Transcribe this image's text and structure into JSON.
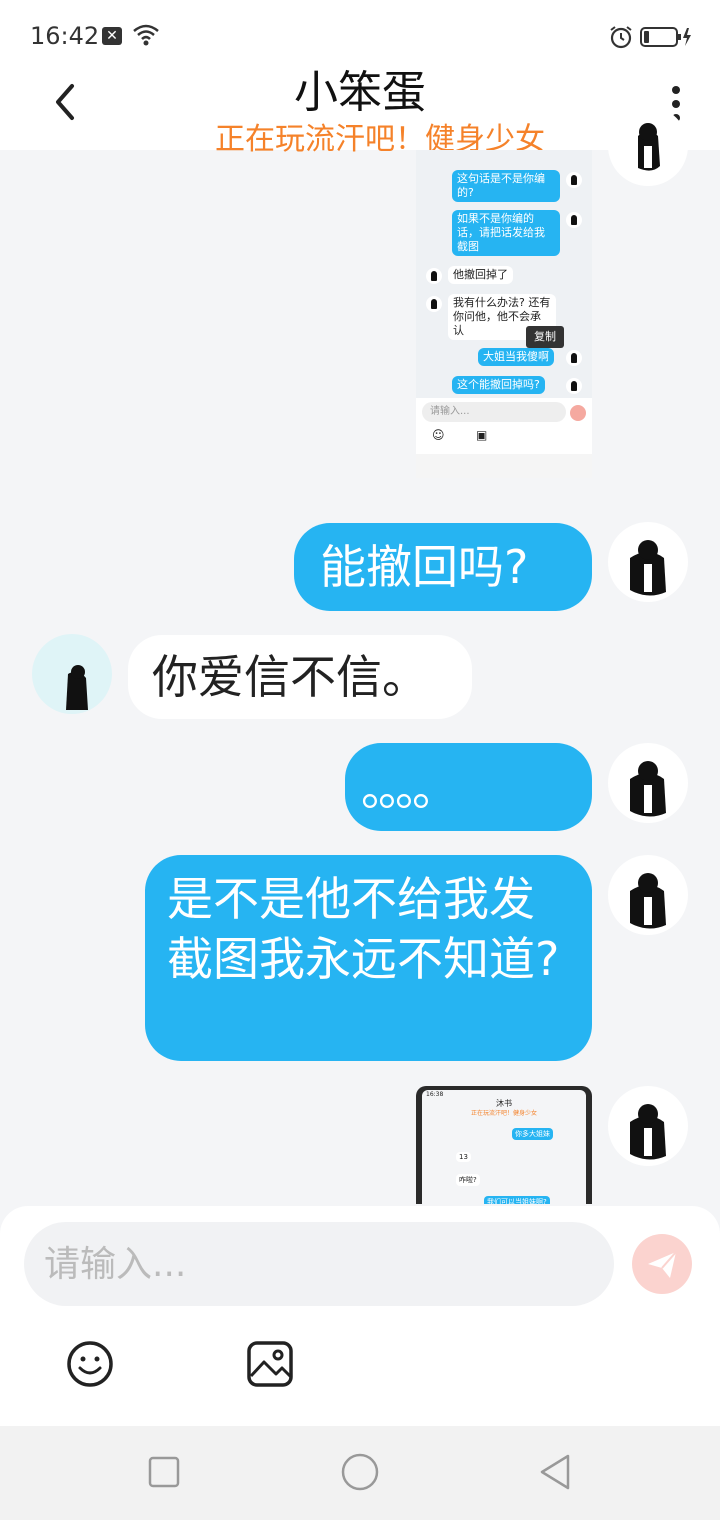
{
  "status_bar": {
    "time": "16:42"
  },
  "header": {
    "title": "小笨蛋",
    "subtitle": "正在玩流汗吧！健身少女"
  },
  "embedded_screenshot_1": {
    "messages": [
      {
        "side": "right",
        "text": "这句话是不是你编的?"
      },
      {
        "side": "right",
        "text": "如果不是你编的话，请把话发给我截图"
      },
      {
        "side": "left",
        "text": "他撤回掉了"
      },
      {
        "side": "left",
        "text": "我有什么办法? 还有你问他，他不会承认"
      },
      {
        "side": "right",
        "text": "大姐当我傻啊"
      },
      {
        "side": "right",
        "text": "这个能撤回掉吗?"
      }
    ],
    "tooltip": "复制",
    "input_placeholder": "请输入..."
  },
  "messages": [
    {
      "side": "right",
      "text": "能撤回吗?"
    },
    {
      "side": "left",
      "text": "你爱信不信。"
    },
    {
      "side": "right",
      "text": "。。。。"
    },
    {
      "side": "right",
      "text": "是不是他不给我发截图我永远不知道?"
    }
  ],
  "embedded_screenshot_2": {
    "time": "16:38",
    "title": "沐书",
    "subtitle": "正在玩流汗吧！健身少女",
    "messages": [
      {
        "side": "right",
        "text": "你多大姐妹"
      },
      {
        "side": "left",
        "text": "13"
      },
      {
        "side": "left",
        "text": "咋啦?"
      },
      {
        "side": "right",
        "text": "我们可以当姐妹啊?"
      }
    ]
  },
  "input": {
    "placeholder": "请输入..."
  },
  "icons": {
    "back": "back-arrow-icon",
    "more": "more-vertical-icon",
    "send": "send-icon",
    "emoji": "emoji-icon",
    "image": "image-icon"
  },
  "colors": {
    "my_bubble": "#26b4f2",
    "other_bubble": "#ffffff",
    "subtitle": "#f5822a",
    "send_button": "#fbd3cf"
  }
}
